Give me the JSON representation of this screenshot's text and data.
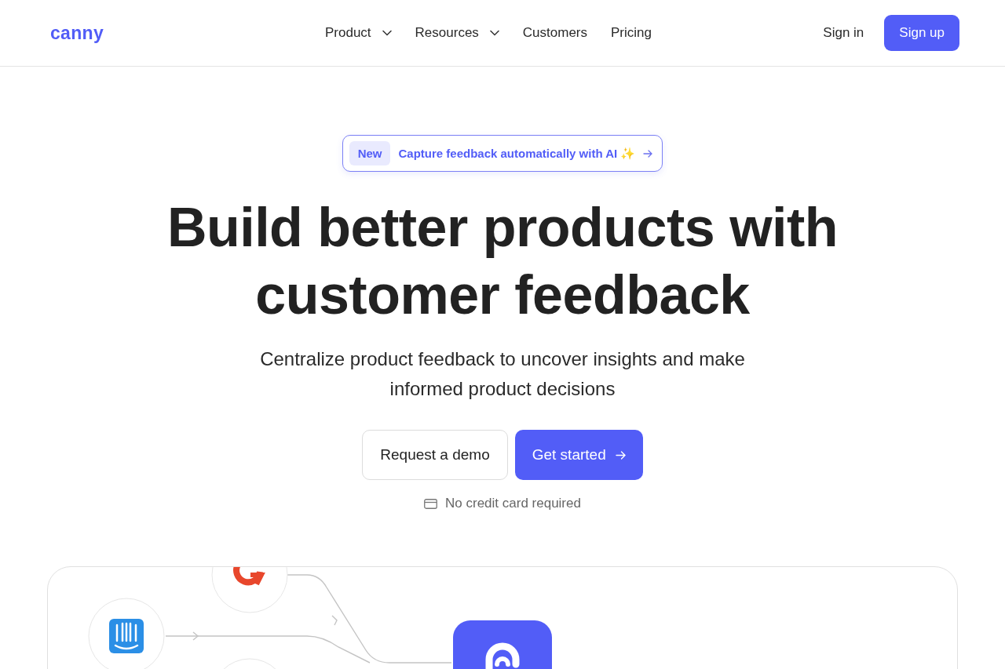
{
  "header": {
    "logo": "canny",
    "nav": [
      {
        "label": "Product",
        "has_menu": true
      },
      {
        "label": "Resources",
        "has_menu": true
      },
      {
        "label": "Customers",
        "has_menu": false
      },
      {
        "label": "Pricing",
        "has_menu": false
      }
    ],
    "sign_in": "Sign in",
    "sign_up": "Sign up"
  },
  "hero": {
    "announcement": {
      "tag": "New",
      "text": "Capture feedback automatically with AI ✨"
    },
    "headline": "Build better products with customer feedback",
    "subtitle": "Centralize product feedback to uncover insights and make informed product decisions",
    "secondary_button": "Request a demo",
    "primary_button": "Get started",
    "note": "No credit card required"
  }
}
